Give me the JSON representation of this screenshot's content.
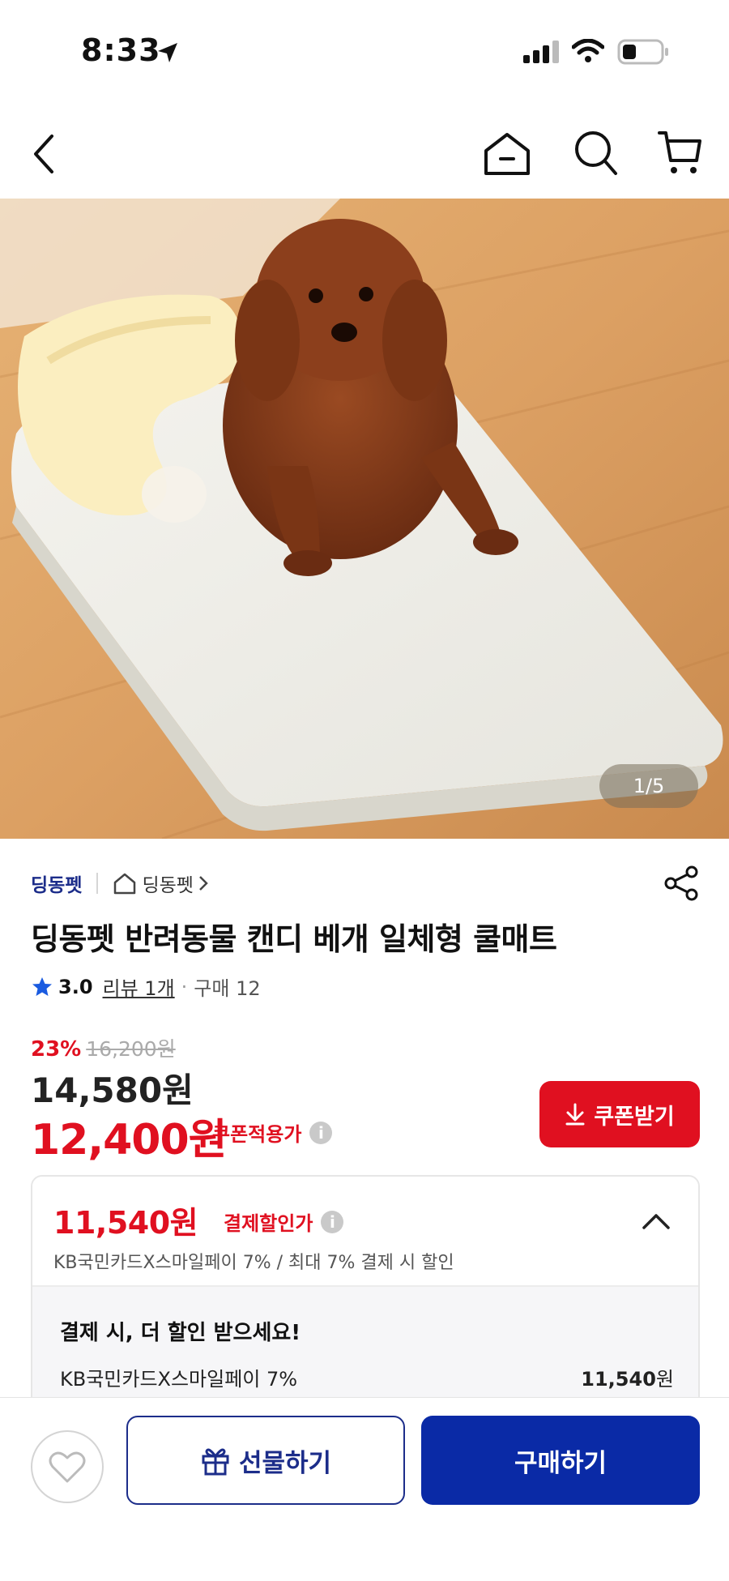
{
  "status_bar": {
    "time": "8:33"
  },
  "nav": {
    "icons": [
      "back-icon",
      "home-icon",
      "search-icon",
      "cart-icon"
    ]
  },
  "product": {
    "image_page": "1/5",
    "seller": "딩동펫",
    "store_link": "딩동펫",
    "title": "딩동펫 반려동물 캔디 베개 일체형 쿨매트",
    "rating": "3.0",
    "review_link": "리뷰 1개",
    "purchase_count": "구매 12",
    "discount_pct": "23%",
    "original_price": "16,200원",
    "price": "14,580원",
    "coupon_price": "12,400원",
    "coupon_label": "쿠폰적용가",
    "coupon_button": "쿠폰받기"
  },
  "payment": {
    "price": "11,540원",
    "label": "결제할인가",
    "description": "KB국민카드X스마일페이 7% / 최대 7% 결제 시 할인",
    "headline": "결제 시, 더 할인 받으세요!",
    "card_name": "KB국민카드X스마일페이 7%",
    "card_amount": "11,540",
    "card_amount_unit": "원"
  },
  "bottom_bar": {
    "gift_label": "선물하기",
    "buy_label": "구매하기"
  },
  "colors": {
    "accent_red": "#e01020",
    "brand_blue": "#0a2aa6",
    "seller_blue": "#1c2d8a"
  }
}
